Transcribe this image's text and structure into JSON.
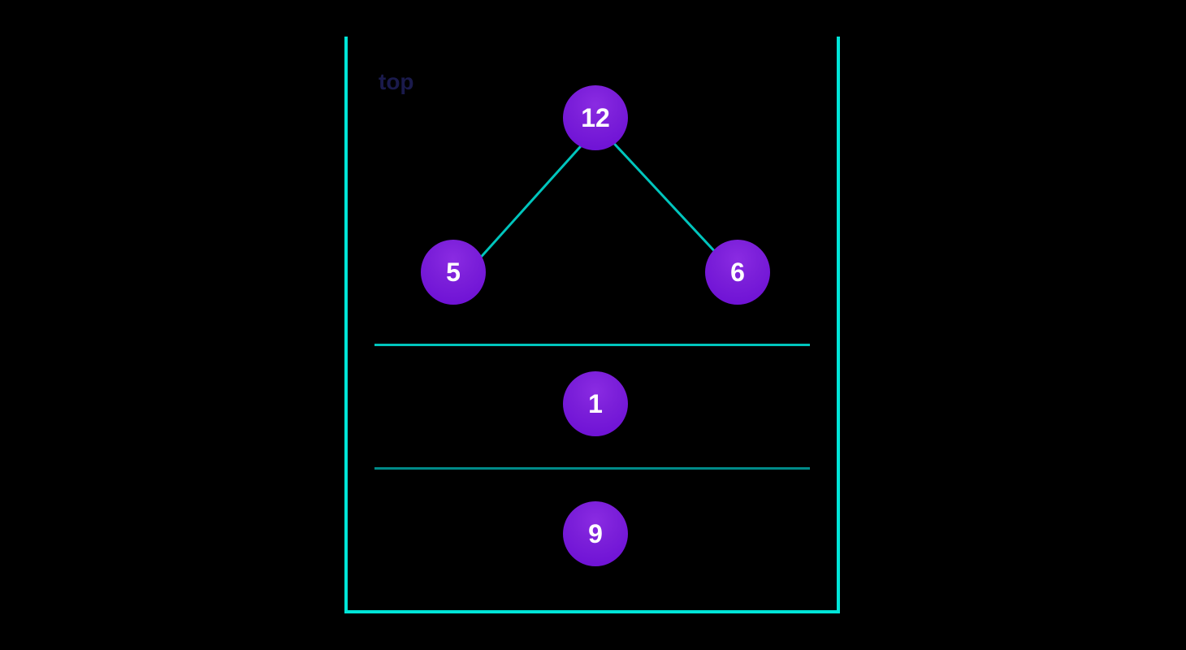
{
  "label": {
    "top": "top"
  },
  "stack": {
    "tree": {
      "root": "12",
      "left": "5",
      "right": "6"
    },
    "middle": "1",
    "bottom": "9"
  },
  "colors": {
    "background": "#000000",
    "container_border": "#00e5d8",
    "divider": "#00c5bd",
    "divider_faded": "#008a88",
    "node_primary": "#8a2be2",
    "node_secondary": "#6a0dd4",
    "label_text": "#1a1a4c",
    "node_text": "#ffffff"
  }
}
